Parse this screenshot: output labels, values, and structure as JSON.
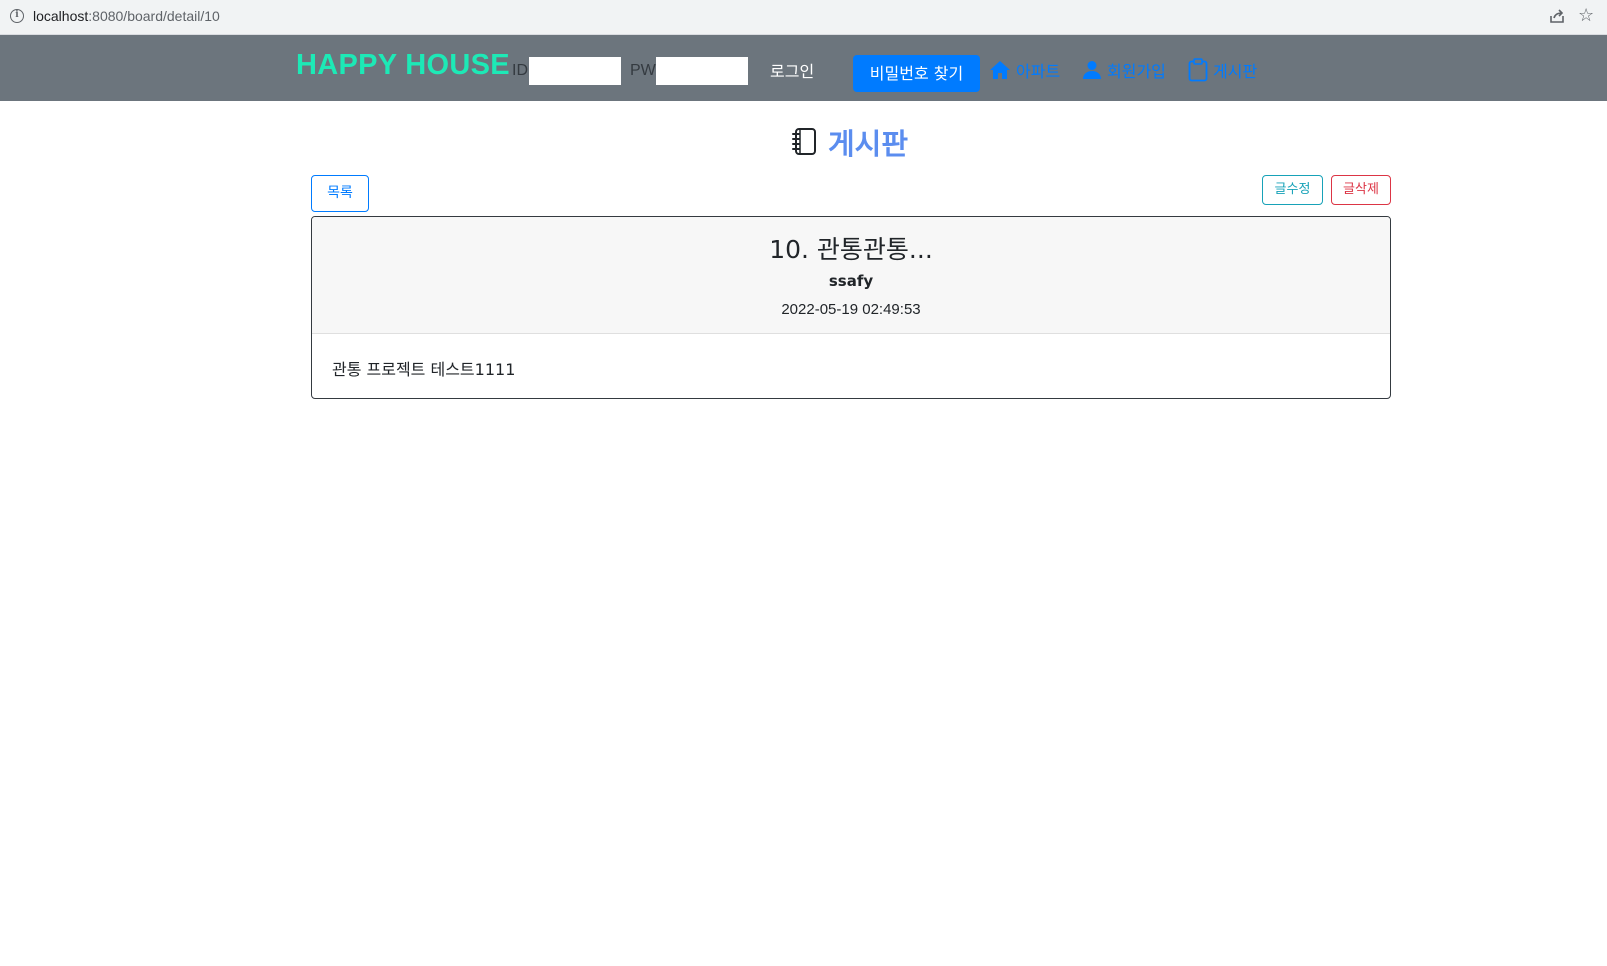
{
  "browser": {
    "url_host": "localhost",
    "url_path": ":8080/board/detail/10"
  },
  "navbar": {
    "brand": "HAPPY HOUSE",
    "id_label": "ID",
    "pw_label": "PW",
    "id_value": "",
    "pw_value": "",
    "login_label": "로그인",
    "find_password_label": "비밀번호 찾기",
    "links": [
      {
        "label": "아파트",
        "icon": "home-icon"
      },
      {
        "label": "회원가입",
        "icon": "user-icon"
      },
      {
        "label": "게시판",
        "icon": "clipboard-icon"
      }
    ],
    "colors": {
      "background": "#6c757d",
      "brand": "#1de9b6",
      "primary": "#007bff"
    }
  },
  "page": {
    "title": "게시판",
    "title_icon": "notebook-icon",
    "title_color": "#5b8def"
  },
  "actions": {
    "list_label": "목록",
    "edit_label": "글수정",
    "delete_label": "글삭제"
  },
  "article": {
    "title": "10. 관통관통...",
    "author": "ssafy",
    "date": "2022-05-19 02:49:53",
    "content": "관통 프로젝트 테스트1111"
  }
}
